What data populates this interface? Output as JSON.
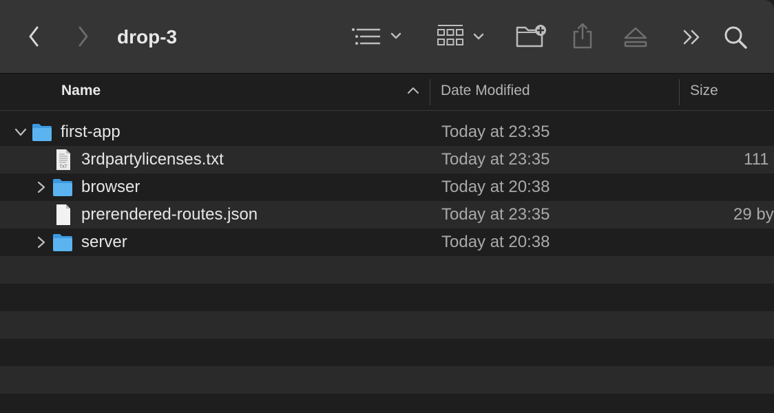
{
  "window": {
    "title": "drop-3"
  },
  "toolbar": {
    "icons": [
      "back-icon",
      "forward-icon",
      "list-view-icon",
      "group-view-icon",
      "new-folder-icon",
      "share-icon",
      "eject-icon",
      "more-icon",
      "search-icon"
    ]
  },
  "columns": {
    "name": "Name",
    "date_modified": "Date Modified",
    "size": "Size",
    "sort": "ascending"
  },
  "files": [
    {
      "name": "first-app",
      "date": "Today at 23:35",
      "size": "",
      "kind": "folder",
      "expanded": true,
      "level": 0
    },
    {
      "name": "3rdpartylicenses.txt",
      "date": "Today at 23:35",
      "size": "111",
      "kind": "txt",
      "level": 1
    },
    {
      "name": "browser",
      "date": "Today at 20:38",
      "size": "",
      "kind": "folder",
      "expanded": false,
      "level": 1
    },
    {
      "name": "prerendered-routes.json",
      "date": "Today at 23:35",
      "size": "29 by",
      "kind": "file",
      "level": 1
    },
    {
      "name": "server",
      "date": "Today at 20:38",
      "size": "",
      "kind": "folder",
      "expanded": false,
      "level": 1
    }
  ],
  "colors": {
    "toolbar_bg": "#353535",
    "list_bg": "#1e1e1e",
    "row_alt_bg": "#2a2a2a",
    "folder_blue": "#5bb4f0"
  }
}
